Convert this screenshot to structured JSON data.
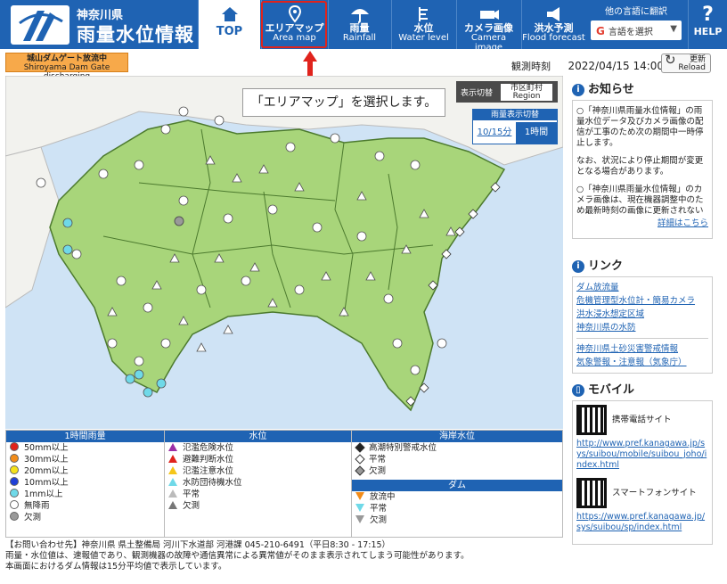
{
  "header": {
    "pref_name": "神奈川県",
    "site_title": "雨量水位情報",
    "nav": [
      {
        "jp": "TOP",
        "en": ""
      },
      {
        "jp": "エリアマップ",
        "en": "Area map"
      },
      {
        "jp": "雨量",
        "en": "Rainfall"
      },
      {
        "jp": "水位",
        "en": "Water level"
      },
      {
        "jp": "カメラ画像",
        "en": "Camera image"
      },
      {
        "jp": "洪水予測",
        "en": "Flood forecast"
      }
    ],
    "lang_title": "他の言語に翻訳",
    "lang_select": "言語を選択",
    "help": "HELP"
  },
  "dam_badge": {
    "jp": "城山ダムゲート放流中",
    "en": "Shiroyama Dam Gate discharging"
  },
  "obs": {
    "label": "観測時刻",
    "time": "2022/04/15 14:00"
  },
  "reload": {
    "jp": "更新",
    "en": "Reload"
  },
  "callout": "「エリアマップ」を選択します。",
  "display_switch": {
    "label": "表示切替",
    "btn_jp": "市区町村",
    "btn_en": "Region"
  },
  "rain_switch": {
    "label": "雨量表示切替",
    "opt1": "10/15分",
    "opt2": "1時間"
  },
  "legend": {
    "rain": {
      "title": "1時間雨量",
      "items": [
        "50mm以上",
        "30mm以上",
        "20mm以上",
        "10mm以上",
        "1mm以上",
        "無降雨",
        "欠測"
      ],
      "colors": [
        "#e0231c",
        "#f28c1a",
        "#f5e21a",
        "#1f3fd6",
        "#6fd9e8",
        "#ffffff",
        "#999999"
      ]
    },
    "water": {
      "title": "水位",
      "items": [
        "氾濫危険水位",
        "避難判断水位",
        "氾濫注意水位",
        "水防団待機水位",
        "平常",
        "欠測"
      ],
      "colors": [
        "#9b2fa6",
        "#e0231c",
        "#f5c61a",
        "#6fd9e8",
        "#ffffff",
        "#999999"
      ]
    },
    "coast": {
      "title": "海岸水位",
      "items": [
        "高潮特別警戒水位",
        "平常",
        "欠測"
      ]
    },
    "dam": {
      "title": "ダム",
      "items": [
        "放流中",
        "平常",
        "欠測"
      ],
      "colors": [
        "#f28c1a",
        "#6fd9e8",
        "#999999"
      ]
    }
  },
  "footer": [
    "【お問い合わせ先】神奈川県 県土整備局 河川下水道部 河港課 045-210-6491（平日8:30 - 17:15）",
    "雨量・水位値は、速報値であり、観測機器の故障や通信異常による異常値がそのまま表示されてしまう可能性があります。",
    "本画面におけるダム情報は15分平均値で表示しています。"
  ],
  "side": {
    "notice_title": "お知らせ",
    "notice_p1": "○「神奈川県雨量水位情報」の雨量水位データ及びカメラ画像の配信が工事のため次の期間中一時停止します。",
    "notice_p2": "なお、状況により停止期間が変更となる場合があります。",
    "notice_p3": "○「神奈川県雨量水位情報」のカメラ画像は、現在機器調整中のため最新時刻の画像に更新されない",
    "notice_more": "詳細はこちら",
    "link_title": "リンク",
    "links": [
      "ダム放流量",
      "危機管理型水位計・簡易カメラ",
      "洪水浸水想定区域",
      "神奈川県の水防",
      "神奈川県土砂災害警戒情報",
      "気象警報・注意報（気象庁）"
    ],
    "mobile_title": "モバイル",
    "mobile1": "携帯電話サイト",
    "mobile1_url": "http://www.pref.kanagawa.jp/sys/suibou/mobile/suibou_joho/index.html",
    "mobile2": "スマートフォンサイト",
    "mobile2_url": "https://www.pref.kanagawa.jp/sys/suibou/sp/index.html"
  }
}
